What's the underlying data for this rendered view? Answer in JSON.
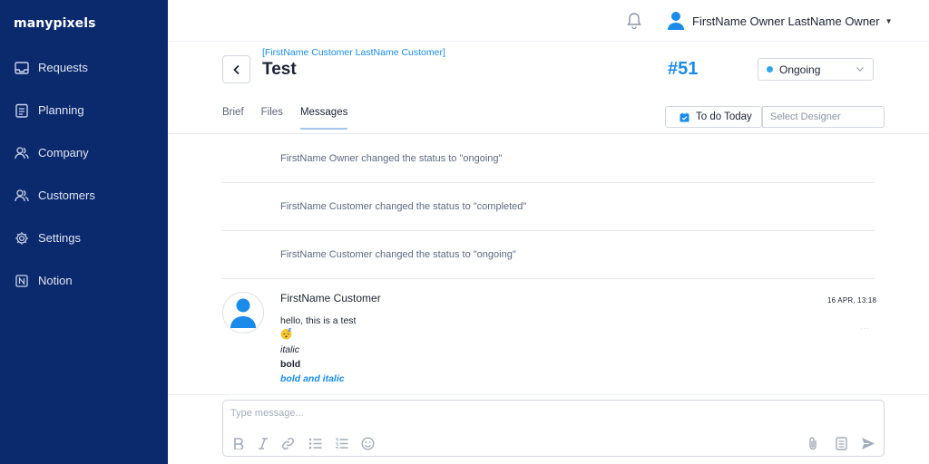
{
  "app": {
    "logo": "manypixels"
  },
  "sidebar": {
    "items": [
      {
        "label": "Requests",
        "icon": "inbox-icon"
      },
      {
        "label": "Planning",
        "icon": "clipboard-icon"
      },
      {
        "label": "Company",
        "icon": "users-icon"
      },
      {
        "label": "Customers",
        "icon": "users-icon"
      },
      {
        "label": "Settings",
        "icon": "gear-icon"
      },
      {
        "label": "Notion",
        "icon": "notion-icon"
      }
    ]
  },
  "header": {
    "user_name": "FirstName Owner LastName Owner"
  },
  "project": {
    "customer_link": "[FirstName Customer LastName Customer]",
    "title": "Test",
    "number": "#51",
    "status": "Ongoing"
  },
  "tabs": [
    {
      "label": "Brief",
      "active": false
    },
    {
      "label": "Files",
      "active": false
    },
    {
      "label": "Messages",
      "active": true
    }
  ],
  "actions": {
    "todo_label": "To do Today",
    "designer_placeholder": "Select Designer"
  },
  "events": [
    "FirstName Owner changed the status to \"ongoing\"",
    "FirstName Customer changed the status to \"completed\"",
    "FirstName Customer changed the status to \"ongoing\""
  ],
  "message": {
    "author": "FirstName Customer",
    "time": "16 APR, 13:18",
    "more": "...",
    "text": "hello, this is a test",
    "italic": "italic",
    "bold": "bold",
    "bold_italic": "bold and italic"
  },
  "composer": {
    "placeholder": "Type message..."
  },
  "colors": {
    "sidebar": "#0b2a6e",
    "accent": "#1a8be8",
    "status_dot": "#2fa6e9"
  }
}
